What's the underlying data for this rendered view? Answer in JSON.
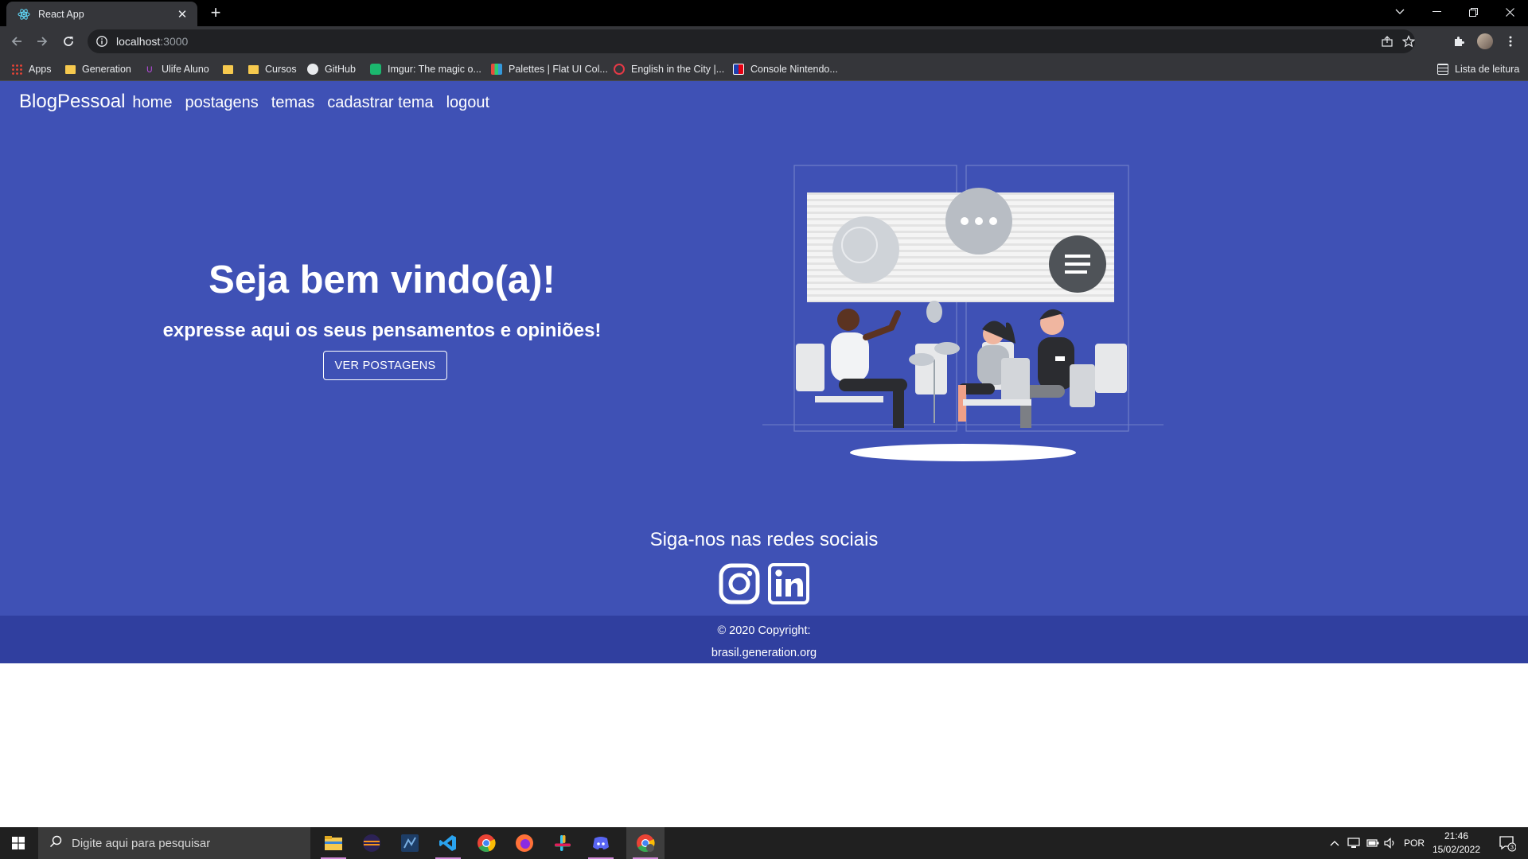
{
  "browser": {
    "tab_title": "React App",
    "url_host": "localhost",
    "url_port": ":3000",
    "bookmarks": [
      {
        "label": "Apps",
        "icon": "apps-grid-icon"
      },
      {
        "label": "Generation",
        "icon": "folder-icon"
      },
      {
        "label": "Ulife Aluno",
        "icon": "ulife-icon"
      },
      {
        "label": "",
        "icon": "folder-icon"
      },
      {
        "label": "Cursos",
        "icon": "folder-icon"
      },
      {
        "label": "GitHub",
        "icon": "github-icon"
      },
      {
        "label": "Imgur: The magic o...",
        "icon": "imgur-icon"
      },
      {
        "label": "Palettes | Flat UI Col...",
        "icon": "palette-icon"
      },
      {
        "label": "English in the City |...",
        "icon": "english-icon"
      },
      {
        "label": "Console Nintendo...",
        "icon": "nintendo-icon"
      }
    ],
    "reading_list": "Lista de leitura"
  },
  "nav": {
    "brand": "BlogPessoal",
    "links": [
      "home",
      "postagens",
      "temas",
      "cadastrar tema",
      "logout"
    ]
  },
  "hero": {
    "title": "Seja bem vindo(a)!",
    "subtitle": "expresse aqui os seus pensamentos e opiniões!",
    "button": "VER POSTAGENS"
  },
  "social": {
    "title": "Siga-nos nas redes sociais",
    "icons": [
      "instagram-icon",
      "linkedin-icon"
    ]
  },
  "footer": {
    "copyright": "© 2020 Copyright:",
    "link": "brasil.generation.org"
  },
  "taskbar": {
    "search_placeholder": "Digite aqui para pesquisar",
    "language": "POR",
    "time": "21:46",
    "date": "15/02/2022",
    "notifications": "3"
  },
  "colors": {
    "page_bg": "#3f51b5",
    "footer_bg": "#303f9f"
  }
}
